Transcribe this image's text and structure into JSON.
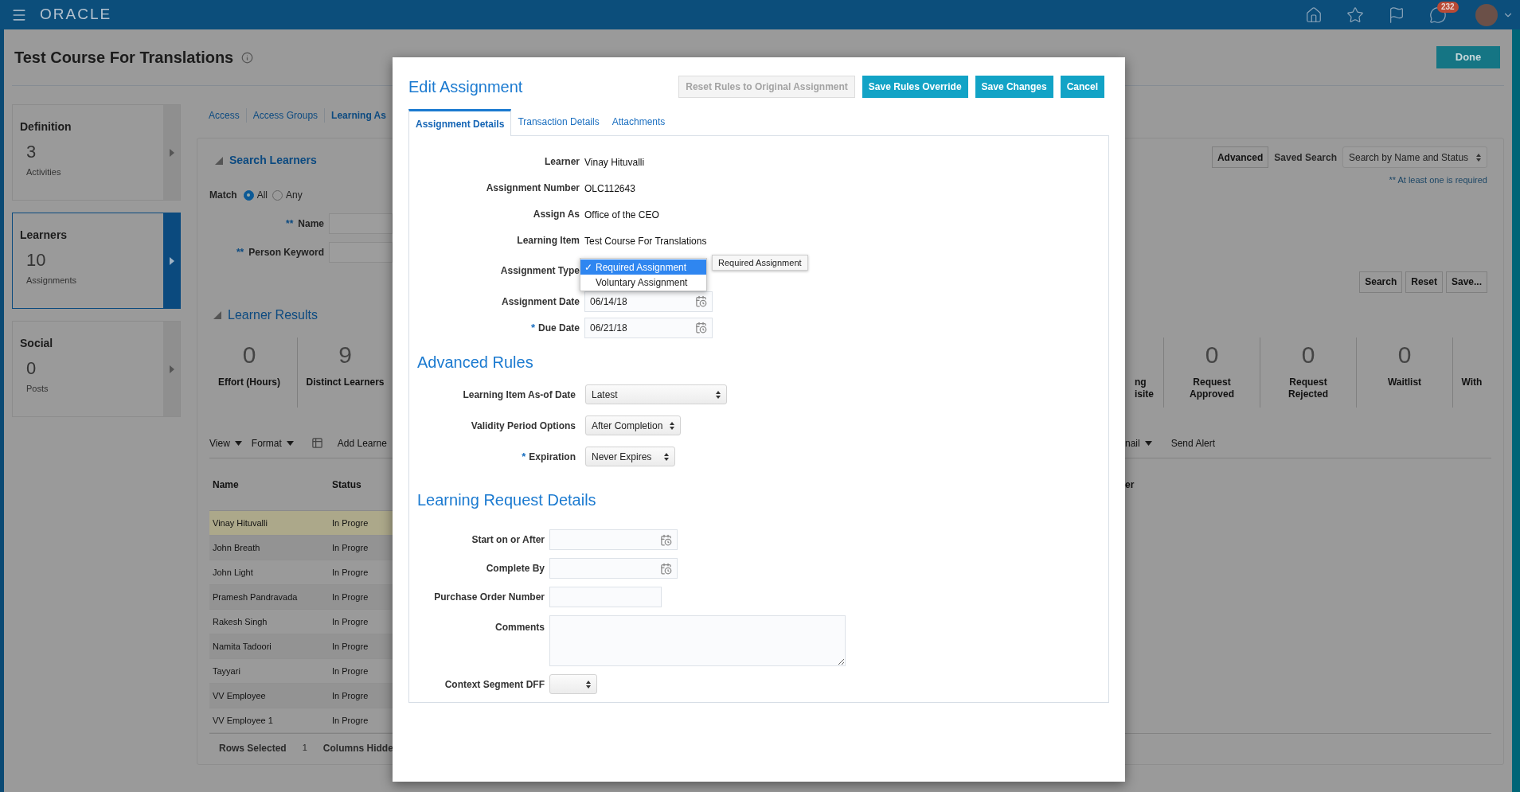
{
  "top_bar": {
    "logo": "ORACLE",
    "notification_count": "232"
  },
  "page": {
    "title": "Test Course For Translations",
    "done_button": "Done"
  },
  "side_cards": [
    {
      "title": "Definition",
      "count": "3",
      "caption": "Activities",
      "selected": false
    },
    {
      "title": "Learners",
      "count": "10",
      "caption": "Assignments",
      "selected": true
    },
    {
      "title": "Social",
      "count": "0",
      "caption": "Posts",
      "selected": false
    }
  ],
  "tabs": [
    {
      "label": "Access",
      "selected": false
    },
    {
      "label": "Access Groups",
      "selected": false
    },
    {
      "label": "Learning As",
      "selected": true
    }
  ],
  "search": {
    "title": "Search Learners",
    "match_label": "Match",
    "match_options": [
      {
        "label": "All",
        "selected": true
      },
      {
        "label": "Any",
        "selected": false
      }
    ],
    "fields": [
      {
        "required_mark": "**",
        "label": "Name"
      },
      {
        "required_mark": "**",
        "label": "Person Keyword"
      }
    ],
    "advanced_button": "Advanced",
    "saved_search_label": "Saved Search",
    "saved_search_value": "Search by Name and Status",
    "required_note": "** At least one is required",
    "buttons": [
      "Search",
      "Reset",
      "Save..."
    ]
  },
  "results": {
    "title": "Learner Results",
    "metrics_left": [
      {
        "value": "0",
        "label_lines": [
          "Effort (Hours)"
        ]
      },
      {
        "value": "9",
        "label_lines": [
          "Distinct Learners"
        ]
      }
    ],
    "metrics_right": [
      {
        "label_lines": [
          "ng",
          "isite"
        ]
      },
      {
        "value": "0",
        "label_lines": [
          "Request",
          "Approved"
        ]
      },
      {
        "value": "0",
        "label_lines": [
          "Request",
          "Rejected"
        ]
      },
      {
        "value": "0",
        "label_lines": [
          "Waitlist"
        ]
      },
      {
        "label_lines": [
          "With"
        ]
      }
    ]
  },
  "toolbar_left": {
    "menus": [
      "View",
      "Format"
    ],
    "action": "Add Learne"
  },
  "toolbar_right": {
    "menu": "nail",
    "action": "Send Alert"
  },
  "table": {
    "columns": [
      "Name",
      "Status"
    ],
    "right_column": "er",
    "rows": [
      {
        "name": "Vinay Hituvalli",
        "status": "In Progre",
        "selected": true
      },
      {
        "name": "John Breath",
        "status": "In Progre",
        "selected": false
      },
      {
        "name": "John Light",
        "status": "In Progre",
        "selected": false
      },
      {
        "name": "Pramesh Pandravada",
        "status": "In Progre",
        "selected": false
      },
      {
        "name": "Rakesh Singh",
        "status": "In Progre",
        "selected": false
      },
      {
        "name": "Namita Tadoori",
        "status": "In Progre",
        "selected": false
      },
      {
        "name": "Tayyari",
        "status": "In Progre",
        "selected": false
      },
      {
        "name": "VV Employee",
        "status": "In Progre",
        "selected": false
      },
      {
        "name": "VV Employee 1",
        "status": "In Progre",
        "selected": false
      }
    ],
    "footer": {
      "rows_selected_label": "Rows Selected",
      "rows_selected_value": "1",
      "columns_hidden_label": "Columns Hidde"
    }
  },
  "dialog": {
    "title": "Edit Assignment",
    "buttons": [
      {
        "label": "Reset Rules to Original Assignment",
        "disabled": true
      },
      {
        "label": "Save Rules Override",
        "disabled": false
      },
      {
        "label": "Save Changes",
        "disabled": false
      },
      {
        "label": "Cancel",
        "disabled": false
      }
    ],
    "tabs": [
      {
        "label": "Assignment Details",
        "selected": true
      },
      {
        "label": "Transaction Details",
        "selected": false
      },
      {
        "label": "Attachments",
        "selected": false
      }
    ],
    "details": [
      {
        "label": "Learner",
        "kind": "text",
        "value": "Vinay Hituvalli"
      },
      {
        "label": "Assignment Number",
        "kind": "text",
        "value": "OLC112643"
      },
      {
        "label": "Assign As",
        "kind": "text",
        "value": "Office of the CEO"
      },
      {
        "label": "Learning Item",
        "kind": "text",
        "value": "Test Course For Translations"
      },
      {
        "label": "Assignment Type",
        "kind": "select"
      },
      {
        "label": "Assignment Date",
        "kind": "date",
        "value": "06/14/18"
      },
      {
        "label": "Due Date",
        "kind": "date",
        "value": "06/21/18",
        "required_mark": "*"
      }
    ],
    "assignment_type_menu": {
      "check": "✓",
      "options": [
        {
          "label": "Required Assignment",
          "selected": true
        },
        {
          "label": "Voluntary Assignment",
          "selected": false
        }
      ],
      "tooltip": "Required Assignment"
    },
    "advanced_rules": {
      "title": "Advanced Rules",
      "fields": [
        {
          "label": "Learning Item As-of Date",
          "value": "Latest"
        },
        {
          "label": "Validity Period Options",
          "value": "After Completion"
        },
        {
          "label": "Expiration",
          "value": "Never Expires",
          "required_mark": "*"
        }
      ]
    },
    "request_details": {
      "title": "Learning Request Details",
      "fields": [
        {
          "label": "Start on or After",
          "kind": "date"
        },
        {
          "label": "Complete By",
          "kind": "date"
        },
        {
          "label": "Purchase Order Number",
          "kind": "text"
        },
        {
          "label": "Comments",
          "kind": "textarea"
        },
        {
          "label": "Context Segment DFF",
          "kind": "select"
        }
      ]
    }
  }
}
